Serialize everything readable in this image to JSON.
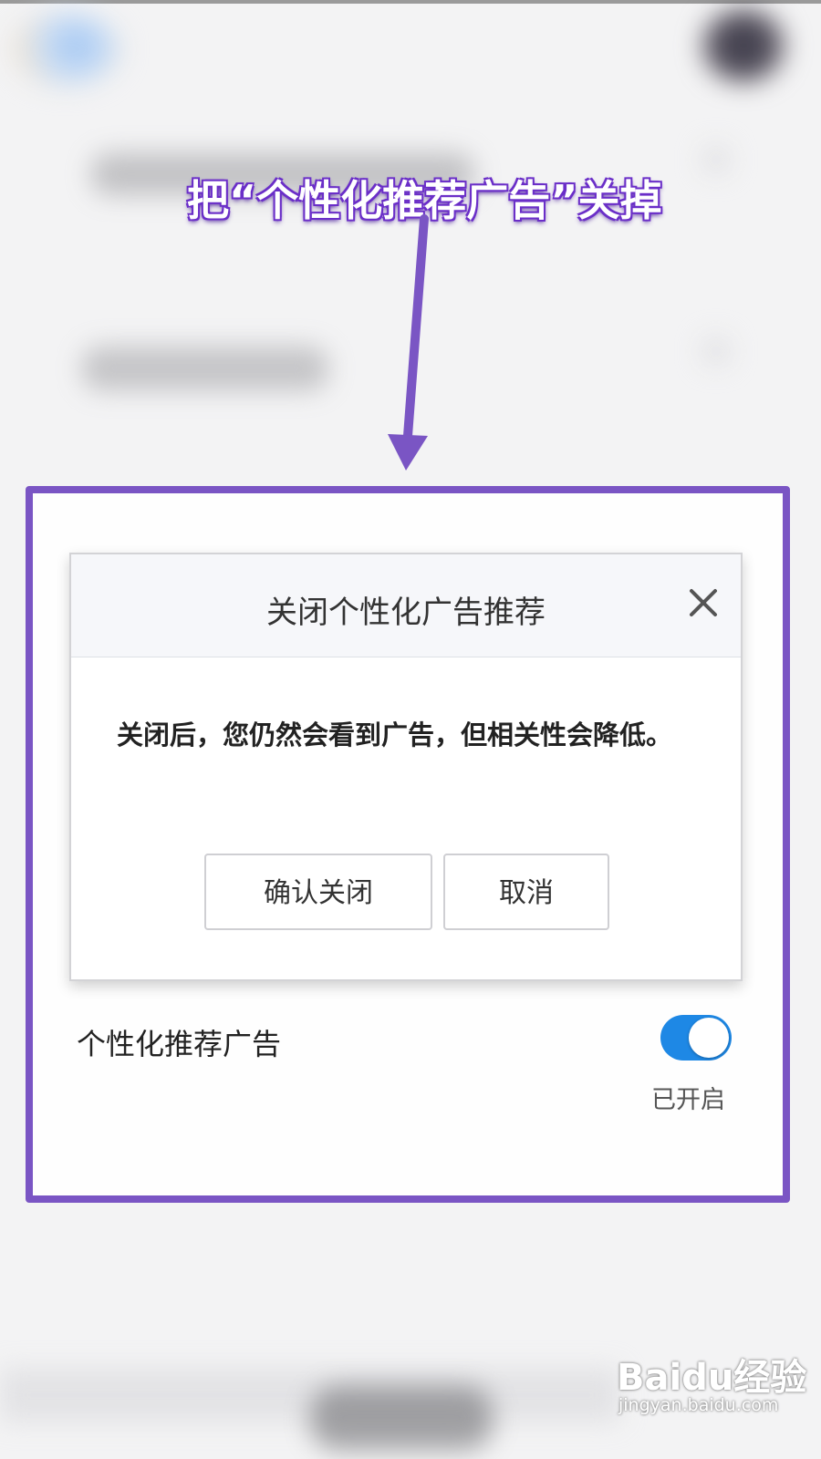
{
  "annotation": {
    "text": "把“个性化推荐广告”关掉",
    "color": "#7a55c4"
  },
  "dialog": {
    "title": "关闭个性化广告推荐",
    "close_icon": "close-icon",
    "message": "关闭后，您仍然会看到广告，但相关性会降低。",
    "confirm_label": "确认关闭",
    "cancel_label": "取消"
  },
  "setting": {
    "label": "个性化推荐广告",
    "toggle_on": true,
    "toggle_color": "#1e88e5",
    "status": "已开启"
  },
  "watermark": {
    "brand": "Baidu经验",
    "site": "jingyan.baidu.com"
  }
}
